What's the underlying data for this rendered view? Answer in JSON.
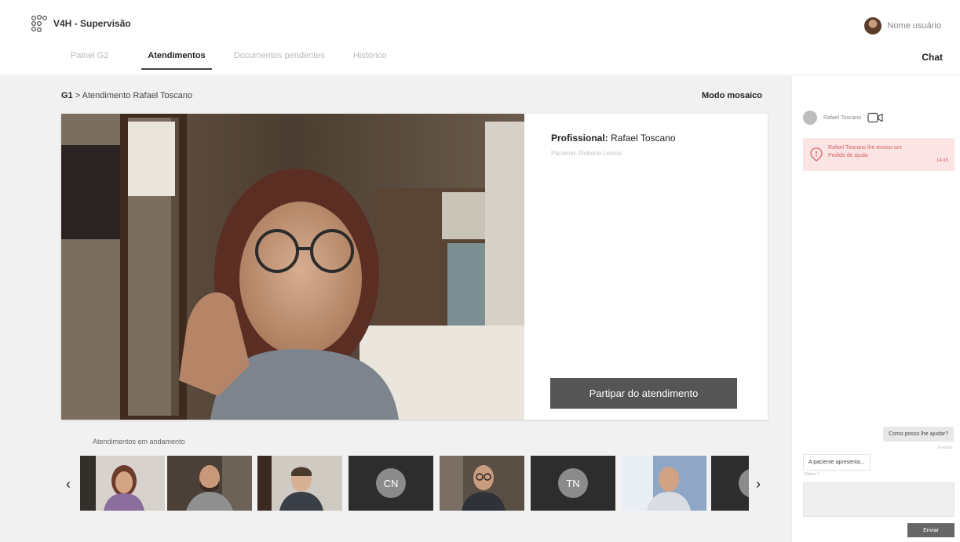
{
  "app": {
    "title": "V4H - Supervisão",
    "user_name": "Nome usuário"
  },
  "nav": {
    "tabs": [
      {
        "label": "Painel G2"
      },
      {
        "label": "Atendimentos",
        "active": true
      },
      {
        "label": "Documentos pendentes"
      },
      {
        "label": "Histórico"
      }
    ],
    "chat_title": "Chat"
  },
  "main": {
    "breadcrumb_group": "G1",
    "breadcrumb_sep": ">",
    "breadcrumb_page": "Atendimento Rafael Toscano",
    "mosaic_label": "Modo mosaico",
    "professional_label": "Profissional:",
    "professional_name": "Rafael Toscano",
    "patient_line": "Paciente: Roberto Lemos",
    "join_button": "Partipar do atendimento",
    "ongoing_label": "Atendimentos em andamento",
    "prev_arrow": "‹",
    "next_arrow": "›",
    "thumbnails": [
      {
        "type": "video"
      },
      {
        "type": "video"
      },
      {
        "type": "video"
      },
      {
        "type": "initials",
        "initials": "CN"
      },
      {
        "type": "video"
      },
      {
        "type": "initials",
        "initials": "TN"
      },
      {
        "type": "video"
      },
      {
        "type": "initials",
        "initials": "J"
      }
    ]
  },
  "chat": {
    "contact_name": "Rafael Toscano",
    "alert_text": "Rafael Toscano lhe enviou um Pedido de ajuda",
    "alert_time": "14:45",
    "outgoing_message": "Como posso lhe ajudar?",
    "outgoing_time": "Enviado",
    "incoming_message": "A paciente apresenta...",
    "incoming_time": "Robert 7",
    "input_placeholder": "",
    "send_button": "Enviar"
  },
  "colors": {
    "accent_dark": "#555555",
    "alert_bg": "#fbe4e4",
    "alert_fg": "#d46464",
    "panel_bg": "#f1f1f1"
  }
}
